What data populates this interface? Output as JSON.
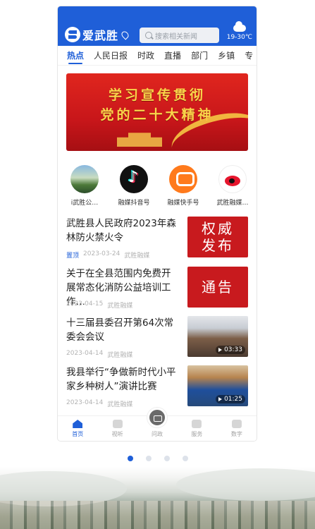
{
  "app": {
    "name": "爱武胜",
    "search_placeholder": "搜索相关新闻",
    "weather": "19-30℃"
  },
  "tabs": [
    "热点",
    "人民日报",
    "时政",
    "直播",
    "部门",
    "乡镇",
    "专"
  ],
  "banner": {
    "line1": "学习宣传贯彻",
    "line2": "党的二十大精神"
  },
  "channels": [
    {
      "label": "i武胜公…",
      "icon": "photo-icon"
    },
    {
      "label": "融媒抖音号",
      "icon": "tiktok-icon"
    },
    {
      "label": "融媒快手号",
      "icon": "kuaishou-icon"
    },
    {
      "label": "武胜融媒…",
      "icon": "weibo-icon"
    }
  ],
  "news": [
    {
      "title": "武胜县人民政府2023年森林防火禁火令",
      "tag": "置顶",
      "date": "2023-03-24",
      "source": "武胜融媒",
      "image_text": "权威 发布"
    },
    {
      "title": "关于在全县范围内免费开展常态化消防公益培训工作…",
      "date": "2023-04-15",
      "source": "武胜融媒",
      "image_text": "通告"
    },
    {
      "title": "十三届县委召开第64次常委会会议",
      "date": "2023-04-14",
      "source": "武胜融媒",
      "video_duration": "03:33"
    },
    {
      "title": "我县举行“争做新时代小平家乡种树人”演讲比赛",
      "date": "2023-04-14",
      "source": "武胜融媒",
      "video_duration": "01:25"
    }
  ],
  "bottom_nav": [
    "首页",
    "视听",
    "问政",
    "服务",
    "数字"
  ],
  "colors": {
    "brand": "#1f5fd8",
    "banner_red": "#c8161a"
  }
}
